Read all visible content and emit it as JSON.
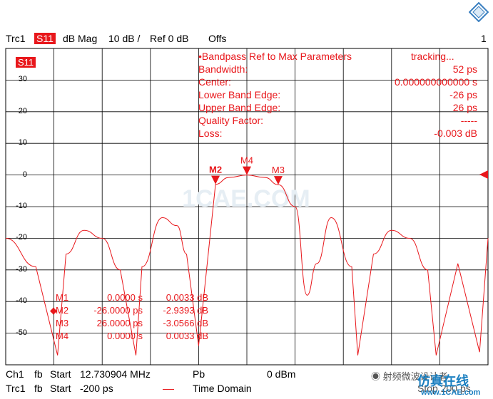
{
  "header": {
    "trace": "Trc1",
    "param": "S11",
    "format": "dB Mag",
    "scale": "10 dB /",
    "ref": "Ref 0 dB",
    "offs": "Offs",
    "channel_num": "1"
  },
  "trace_badge": "S11",
  "y_ticks": [
    "30",
    "20",
    "10",
    "0",
    "-10",
    "-20",
    "-30",
    "-40",
    "-50"
  ],
  "bandpass": {
    "title": "•Bandpass Ref to Max Parameters",
    "mode": "tracking...",
    "rows": [
      {
        "label": "Bandwidth:",
        "value": "52 ps"
      },
      {
        "label": "Center:",
        "value": "0.000000000000 s"
      },
      {
        "label": "Lower Band Edge:",
        "value": "-26 ps"
      },
      {
        "label": "Upper Band Edge:",
        "value": "26 ps"
      },
      {
        "label": "Quality Factor:",
        "value": "-----"
      },
      {
        "label": "Loss:",
        "value": "-0.003 dB"
      }
    ]
  },
  "markers_on_plot": [
    {
      "label": "M2",
      "pos_ps": -26,
      "db": -2.9393
    },
    {
      "label": "M4",
      "pos_ps": 0,
      "db": 0.0033
    },
    {
      "label": "M3",
      "pos_ps": 26,
      "db": -3.0566
    }
  ],
  "marker_table": [
    {
      "sel": "",
      "name": "M1",
      "x": "0.0000 s",
      "y": "0.0033 dB"
    },
    {
      "sel": "◆",
      "name": "M2",
      "x": "-26.0000 ps",
      "y": "-2.9393 dB"
    },
    {
      "sel": "",
      "name": "M3",
      "x": "26.0000 ps",
      "y": "-3.0566 dB"
    },
    {
      "sel": "",
      "name": "M4",
      "x": "0.0000 s",
      "y": "0.0033 dB"
    }
  ],
  "footer": {
    "row1": {
      "ch": "Ch1",
      "fb": "fb",
      "start_label": "Start",
      "start_value": "12.730904 MHz",
      "pb": "Pb",
      "power": "0 dBm"
    },
    "row2": {
      "ch": "Trc1",
      "fb": "fb",
      "start_label": "Start",
      "start_value": "-200 ps",
      "domain": "Time Domain",
      "stop": "Stop 200 ps"
    }
  },
  "watermark_text": "1CAE.COM",
  "watermark_cn": "射频微波设计者",
  "site_cn": "仿真在线",
  "site_url": "www.1CAE.com",
  "colors": {
    "trace": "#e8171b",
    "grid": "#000000",
    "accent": "#e8171b"
  },
  "chart_data": {
    "type": "line",
    "x_unit": "ps",
    "y_unit": "dB",
    "xlim": [
      -200,
      200
    ],
    "ylim": [
      -60,
      40
    ],
    "series": [
      {
        "name": "Trc1 S11",
        "x": [
          -200,
          -175,
          -157,
          -150,
          -135,
          -120,
          -105,
          -92,
          -87,
          -70,
          -58,
          -50,
          -40,
          -26,
          -15,
          0,
          15,
          26,
          40,
          50,
          58,
          70,
          87,
          92,
          105,
          120,
          135,
          150,
          157,
          175,
          193,
          200
        ],
        "y": [
          -20,
          -29,
          -57,
          -25,
          -17.5,
          -20,
          -30,
          -57,
          -29,
          -13.5,
          -16,
          -25,
          -54,
          -2.94,
          -0.8,
          0,
          -0.8,
          -3.06,
          -10,
          -38,
          -28,
          -13.5,
          -29,
          -57,
          -25,
          -17.5,
          -20,
          -30,
          -57,
          -28,
          -56,
          -20
        ]
      }
    ]
  }
}
